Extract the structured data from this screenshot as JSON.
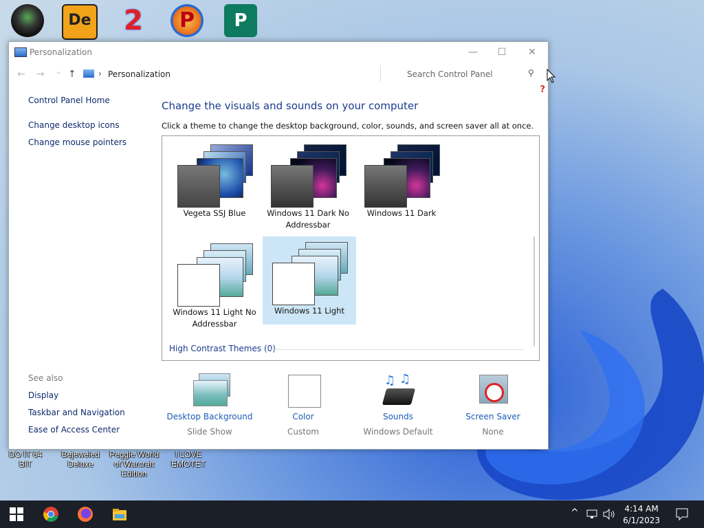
{
  "window": {
    "title": "Personalization",
    "minimize": "—",
    "maximize": "☐",
    "close": "✕"
  },
  "address": {
    "breadcrumb": "Personalization",
    "back": "←",
    "forward": "→",
    "dropdown": "⌄",
    "up": "↑",
    "separator": "›"
  },
  "search": {
    "placeholder": "Search Control Panel",
    "icon": "search-icon"
  },
  "help": "?",
  "sidebar": {
    "home": "Control Panel Home",
    "links": [
      "Change desktop icons",
      "Change mouse pointers"
    ],
    "see_also_title": "See also",
    "see_also": [
      "Display",
      "Taskbar and Navigation",
      "Ease of Access Center"
    ]
  },
  "main": {
    "heading": "Change the visuals and sounds on your computer",
    "subtitle": "Click a theme to change the desktop background, color, sounds, and screen saver all at once.",
    "themes": [
      {
        "name": "Vegeta SSJ Blue",
        "selected": false
      },
      {
        "name": "Windows 11 Dark No Addressbar",
        "selected": false
      },
      {
        "name": "Windows 11 Dark",
        "selected": false
      },
      {
        "name": "Windows 11 Light No Addressbar",
        "selected": false
      },
      {
        "name": "Windows 11 Light",
        "selected": true
      }
    ],
    "high_contrast": "High Contrast Themes (0)"
  },
  "bottom": [
    {
      "label": "Desktop Background",
      "value": "Slide Show"
    },
    {
      "label": "Color",
      "value": "Custom"
    },
    {
      "label": "Sounds",
      "value": "Windows Default"
    },
    {
      "label": "Screen Saver",
      "value": "None"
    }
  ],
  "desktop": {
    "labels": [
      "DO IT 64 BIT",
      "Bejeweled Deluxe",
      "Peggle World of Warcraft Edition",
      "I LOVE EMOTET"
    ]
  },
  "taskbar": {
    "time": "4:14 AM",
    "date": "6/1/2023",
    "tray_chevron": "^"
  },
  "colors": {
    "accent": "#1a3b8f",
    "link": "#1a5bb5",
    "selection": "#cde6f7",
    "taskbar": "#1b1f27"
  }
}
